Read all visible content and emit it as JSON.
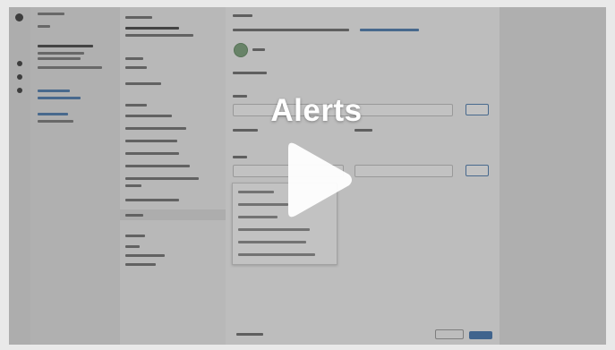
{
  "video": {
    "title": "Alerts",
    "play_icon": "play-icon"
  },
  "colors": {
    "overlay": "#464646",
    "title": "#ffffff",
    "accent": "#3e73b0"
  }
}
